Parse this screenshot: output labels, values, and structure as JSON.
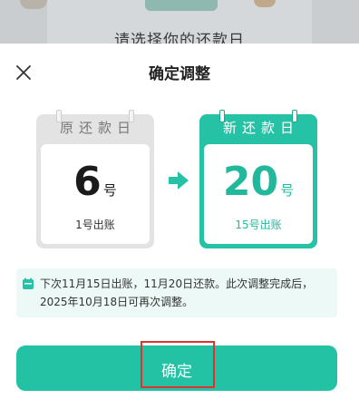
{
  "background": {
    "title": "请选择你的还款日"
  },
  "sheet": {
    "title": "确定调整",
    "close_icon": "close-icon"
  },
  "original": {
    "header": "原还款日",
    "day": "6",
    "unit": "号",
    "bill": "1号出账"
  },
  "new": {
    "header": "新还款日",
    "day": "20",
    "unit": "号",
    "bill": "15号出账"
  },
  "arrow_icon": "arrow-right-icon",
  "notice": {
    "icon": "calendar-icon",
    "text": "下次11月15日出账，11月20日还款。此次调整完成后，2025年10月18日可再次调整。"
  },
  "confirm": {
    "label": "确定"
  },
  "colors": {
    "accent": "#24c2a5",
    "highlight": "#e0322f"
  }
}
